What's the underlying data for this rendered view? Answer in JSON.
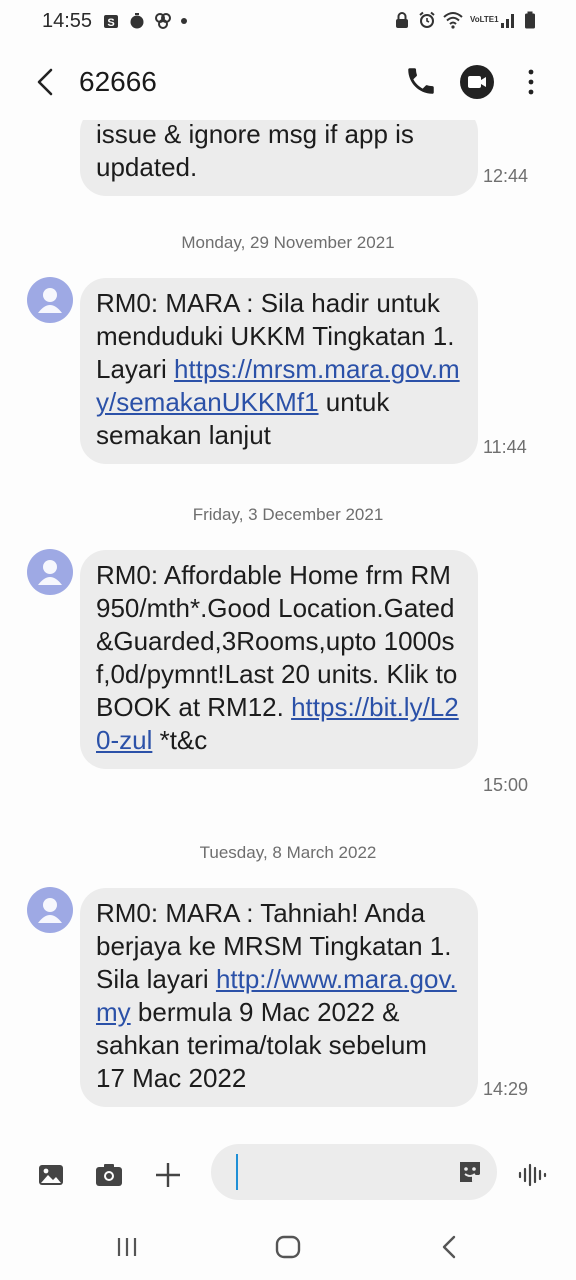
{
  "status": {
    "time": "14:55",
    "left_icons": [
      "s-app-icon",
      "timer-icon",
      "pinwheel-icon",
      "dot-icon"
    ],
    "right_icons": [
      "lock-icon",
      "alarm-icon",
      "wifi-icon",
      "volte-icon",
      "signal-icon",
      "battery-icon"
    ],
    "volte_label": "VoLTE1"
  },
  "header": {
    "contact": "62666",
    "icons": [
      "back-icon",
      "phone-icon",
      "video-icon",
      "more-icon"
    ]
  },
  "messages": [
    {
      "type": "incoming",
      "parts": [
        {
          "text": "issue & ignore msg if app is"
        },
        {
          "text": "updated."
        }
      ],
      "time": "12:44"
    },
    {
      "type": "date",
      "label": "Monday, 29 November 2021"
    },
    {
      "type": "incoming",
      "parts": [
        {
          "text": "RM0: MARA : Sila hadir untuk menduduki UKKM Tingkatan 1. Layari "
        },
        {
          "link": "https://mrsm.mara.gov.my/semakanUKKMf1"
        },
        {
          "text": " untuk semakan lanjut"
        }
      ],
      "time": "11:44"
    },
    {
      "type": "date",
      "label": "Friday, 3 December 2021"
    },
    {
      "type": "incoming",
      "parts": [
        {
          "text": "RM0: Affordable Home frm RM950/mth*.Good Location.Gated&Guarded,3Rooms,upto 1000sf,0d/pymnt!Last 20 units. Klik to BOOK at RM12. "
        },
        {
          "link": "https://bit.ly/L20-zul"
        },
        {
          "text": " *t&c"
        }
      ],
      "time": "15:00"
    },
    {
      "type": "date",
      "label": "Tuesday, 8 March 2022"
    },
    {
      "type": "incoming",
      "parts": [
        {
          "text": "RM0: MARA : Tahniah! Anda berjaya ke MRSM Tingkatan 1. Sila layari "
        },
        {
          "link": "http://www.mara.gov.my"
        },
        {
          "text": " bermula 9 Mac 2022 & sahkan terima/tolak sebelum 17 Mac 2022"
        }
      ],
      "time": "14:29"
    }
  ],
  "composer": {
    "input_value": "",
    "icons": [
      "gallery-icon",
      "camera-icon",
      "plus-icon",
      "sticker-icon",
      "voice-icon"
    ]
  },
  "navbar": {
    "icons": [
      "recents-icon",
      "home-icon",
      "back-nav-icon"
    ]
  },
  "colors": {
    "bubble": "#ececec",
    "link": "#2b51a8",
    "avatar": "#9ea9e4",
    "caret": "#1f8fd6"
  }
}
